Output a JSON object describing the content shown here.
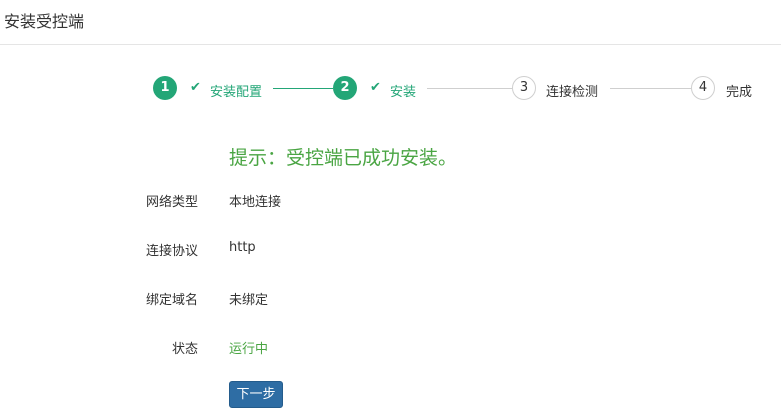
{
  "header": {
    "title": "安装受控端"
  },
  "steps": [
    {
      "number": "1",
      "label": "安装配置",
      "status": "done"
    },
    {
      "number": "2",
      "label": "安装",
      "status": "done"
    },
    {
      "number": "3",
      "label": "连接检测",
      "status": "todo"
    },
    {
      "number": "4",
      "label": "完成",
      "status": "todo"
    }
  ],
  "tip": "提示：受控端已成功安装。",
  "info": {
    "network_type_label": "网络类型",
    "network_type_value": "本地连接",
    "protocol_label": "连接协议",
    "protocol_value": "http",
    "domain_label": "绑定域名",
    "domain_value": "未绑定",
    "status_label": "状态",
    "status_value": "运行中"
  },
  "buttons": {
    "next": "下一步"
  },
  "colors": {
    "done": "#23a677",
    "tip": "#4aa543",
    "button": "#2e6da4"
  }
}
